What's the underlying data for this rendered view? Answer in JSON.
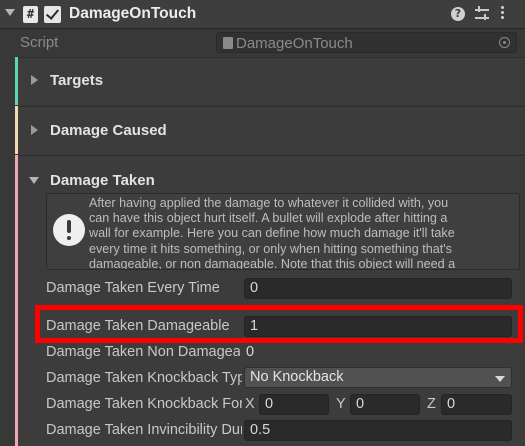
{
  "component": {
    "title": "DamageOnTouch",
    "cs_glyph": "#",
    "enabled": true,
    "help_glyph": "?"
  },
  "script": {
    "label": "Script",
    "value": "DamageOnTouch"
  },
  "sections": {
    "targets": {
      "title": "Targets",
      "color": "#5fd6b3"
    },
    "damage_caused": {
      "title": "Damage Caused",
      "color": "#f3d9b1"
    },
    "damage_taken": {
      "title": "Damage Taken",
      "color": "#f3a6b4"
    }
  },
  "helpbox": {
    "lines": [
      "After having applied the damage to whatever it collided with, you",
      "can have this object hurt itself. A bullet will explode after hitting a",
      "wall for example. Here you can define how much damage it'll take",
      "every time it hits something, or only when hitting something that's",
      "damageable, or non damageable. Note that this object will need a"
    ]
  },
  "fields": {
    "every_time": {
      "label": "Damage Taken Every Time",
      "value": "0"
    },
    "damageable": {
      "label": "Damage Taken Damageable",
      "value": "1"
    },
    "non_damageable": {
      "label": "Damage Taken Non Damageable",
      "value": "0"
    },
    "knockback": {
      "label": "Damage Taken Knockback Type",
      "value": "No Knockback"
    },
    "knockback_force": {
      "label": "Damage Taken Knockback Force",
      "x_label": "X",
      "x_value": "0",
      "y_label": "Y",
      "y_value": "0",
      "z_label": "Z",
      "z_value": "0"
    },
    "invincibility": {
      "label": "Damage Taken Invincibility Duration",
      "value": "0.5"
    }
  },
  "highlight_color": "#ff0000"
}
